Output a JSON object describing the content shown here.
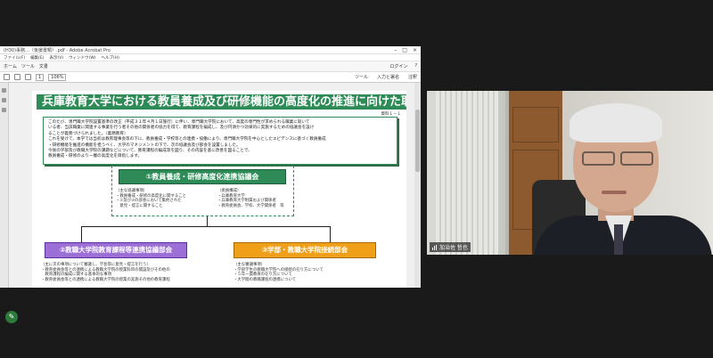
{
  "app": {
    "title": "(H30)事務…（後援書類）.pdf - Adobe Acrobat Pro",
    "menu": [
      "ファイル(F)",
      "編集(E)",
      "表示(V)",
      "ウィンドウ(W)",
      "ヘルプ(H)"
    ],
    "toolbar_left": [
      "ホーム",
      "ツール",
      "文書"
    ],
    "toolbar_right": [
      "ログイン",
      "?"
    ],
    "page_number": "1",
    "zoom": "106%",
    "toolbar2_right": [
      "ツール",
      "入力と署名",
      "注釈"
    ]
  },
  "document": {
    "title": "兵庫教育大学における教員養成及び研修機能の高度化の推進に向けた取組",
    "ref": "資料１－１",
    "intro": [
      "このたび、専門職大学院設置基準の改正（平成３１年４月１日施行）に伴い、専門職大学院において、高度の専門性が求められる職業に就いて",
      "いる者、当該職業に関連する事業を行う者その他の関係者の協力を得て、教育課程を編成し、及び円滑かつ効果的に実施するための協議会を設け",
      "ることが義務づけられました。（義務教育）",
      "これを受けて、本学では当初は教育理事会等の下に、教員養成・学校等との連携・協働により、専門職大学院を中心としたエビデンスに基づく教員養成",
      "・研修機能を推進の機能を担うべく、大学のマネジメントの下で、次の協議会及び部会を設置しました。",
      "今後の学部及び教職大学院の課題などについて、教育課程の編成等を図り、その内容を基に改善を図ることで、",
      "教員養成・研修のより一層の高度化を目指します。"
    ],
    "council_main": "①教員養成・研修高度化連携協議会",
    "main_notes": [
      "（主な協議事項）",
      "・教員養成・研修の高度化に関すること",
      "・②及び③の部会において集約された",
      "　意見・提言に関すること"
    ],
    "main_members": [
      "（委員構成）",
      "・兵庫教育大学",
      "・兵庫教育大学附属および関係者",
      "・教育委員会、学校、大学関係者　等"
    ],
    "council_left": "②教職大学院教育課程等連携協議部会",
    "council_right": "③学部・教職大学院接続部会",
    "left_notes": [
      "（主に次の事項について審議し、学長等に意見・提言を行う）",
      "・教育委員会等との連携による教職大学院の授業科目の開設及びその他の",
      "　教育課程の編成に関する基本的な事項",
      "・教育委員会等との連携による教職大学院の授業の実施その他の教育課程"
    ],
    "right_notes": [
      "（主な審議事項）",
      "・学部学生の教職大学院への接続の在り方について",
      "・５年一貫教育の在り方について",
      "・大学間の教職課程の連携について"
    ]
  },
  "participant": {
    "name": "加治佐 哲也"
  },
  "share_icon": "pencil-icon",
  "colors": {
    "doc_green": "#2e8b57",
    "purple": "#9b6fd6",
    "orange": "#f0a018"
  }
}
